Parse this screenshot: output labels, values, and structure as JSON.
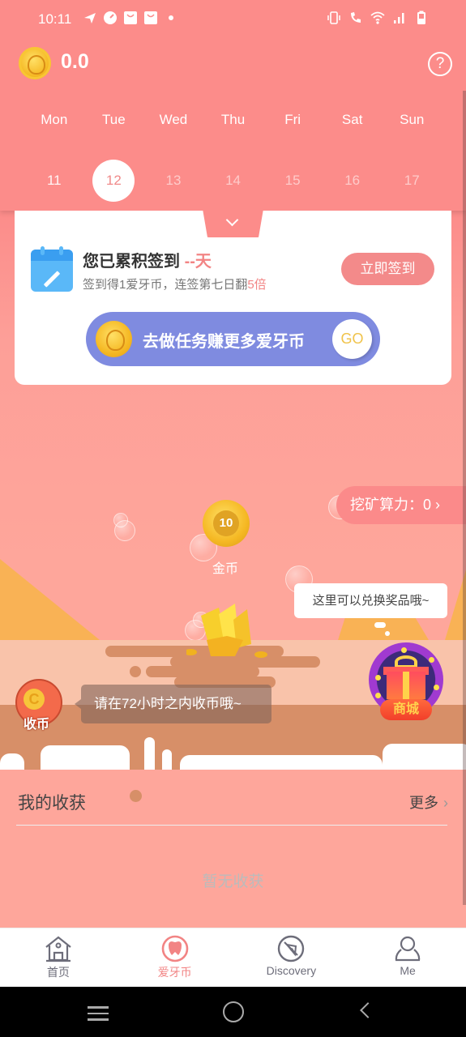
{
  "status_bar": {
    "time": "10:11",
    "left_icons": [
      "telegram-icon",
      "speedometer-icon",
      "shopping-bag-icon",
      "shopping-bag-icon",
      "dot-icon"
    ],
    "right_icons": [
      "vibrate-icon",
      "wifi-call-icon",
      "wifi-icon",
      "signal-icon",
      "battery-icon"
    ]
  },
  "header": {
    "balance": "0.0",
    "help_label": "?"
  },
  "calendar": {
    "weekdays": [
      "Mon",
      "Tue",
      "Wed",
      "Thu",
      "Fri",
      "Sat",
      "Sun"
    ],
    "dates": [
      "11",
      "12",
      "13",
      "14",
      "15",
      "16",
      "17"
    ],
    "today_index": 1
  },
  "checkin_card": {
    "title_prefix": "您已累积签到",
    "title_days": "--天",
    "subtitle_prefix": "签到得1爱牙币，连签第七日翻",
    "subtitle_multiplier": "5倍",
    "sign_button": "立即签到",
    "task_button": "去做任务赚更多爱牙币",
    "task_go": "GO"
  },
  "mining": {
    "power_label": "挖矿算力：0",
    "coin_value": "10",
    "coin_label": "金币",
    "prize_hint": "这里可以兑换奖品哦~",
    "shop_label": "商城",
    "collect_label": "收币",
    "collect_hint": "请在72小时之内收币哦~"
  },
  "harvest": {
    "title": "我的收获",
    "more": "更多",
    "empty": "暂无收获"
  },
  "tabs": [
    {
      "label": "首页",
      "icon": "home-icon"
    },
    {
      "label": "爱牙币",
      "icon": "tooth-coin-icon",
      "active": true
    },
    {
      "label": "Discovery",
      "icon": "compass-icon"
    },
    {
      "label": "Me",
      "icon": "person-icon"
    }
  ],
  "colors": {
    "primary": "#fc8c8a",
    "accent_text": "#f28484",
    "task_button": "#7f8be0",
    "ground": "#d78f68"
  }
}
